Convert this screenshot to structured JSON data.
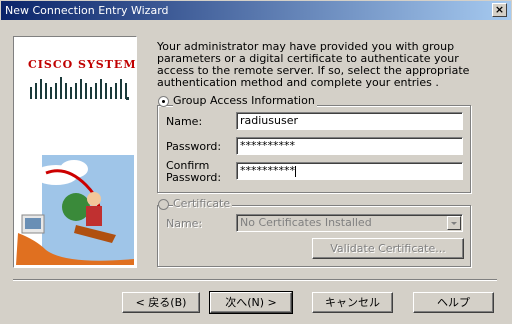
{
  "window": {
    "title": "New Connection Entry Wizard",
    "close_label": "×"
  },
  "logo": {
    "text": "Cisco Systems"
  },
  "intro_text": "Your administrator may have provided you with group parameters or a digital certificate to authenticate your access to the remote server.  If so, select the appropriate authentication method and complete your entries .",
  "group_access": {
    "label": "Group Access Information",
    "selected": true,
    "name_label": "Name:",
    "name_value": "radiususer",
    "password_label": "Password:",
    "password_value": "**********",
    "confirm_label_1": "Confirm",
    "confirm_label_2": "Password:",
    "confirm_value": "**********"
  },
  "certificate": {
    "label": "Certificate",
    "name_label": "Name:",
    "dropdown_value": "No Certificates Installed",
    "validate_label": "Validate Certificate..."
  },
  "buttons": {
    "back": "< 戻る(B)",
    "next": "次へ(N) >",
    "cancel": "キャンセル",
    "help": "ヘルプ"
  }
}
